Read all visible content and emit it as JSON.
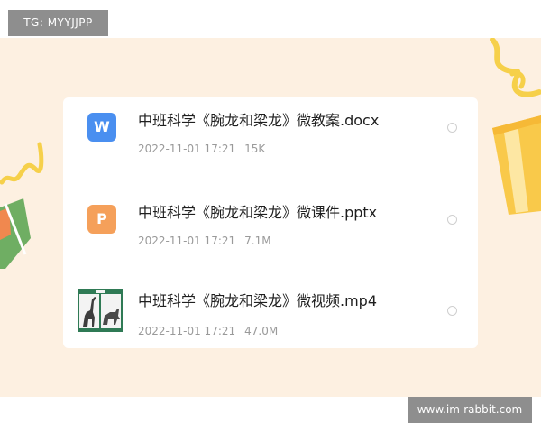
{
  "header": {
    "tg_label": "TG: MYYJJPP"
  },
  "footer": {
    "watermark": "www.im-rabbit.com"
  },
  "colors": {
    "backdrop": "#fdf0e1",
    "word_icon": "#4a8ff0",
    "ppt_icon": "#f5a05a",
    "label_gray": "#8e8e8e",
    "ribbon_yellow": "#f6d04a",
    "gift_green": "#6fae63",
    "gift_orange": "#f0884f"
  },
  "files": [
    {
      "name": "中班科学《腕龙和梁龙》微教案.docx",
      "date": "2022-11-01 17:21",
      "size": "15K",
      "icon": "word-icon",
      "icon_glyph": "W"
    },
    {
      "name": "中班科学《腕龙和梁龙》微课件.pptx",
      "date": "2022-11-01 17:21",
      "size": "7.1M",
      "icon": "powerpoint-icon",
      "icon_glyph": "P"
    },
    {
      "name": "中班科学《腕龙和梁龙》微视频.mp4",
      "date": "2022-11-01 17:21",
      "size": "47.0M",
      "icon": "video-thumbnail"
    }
  ]
}
